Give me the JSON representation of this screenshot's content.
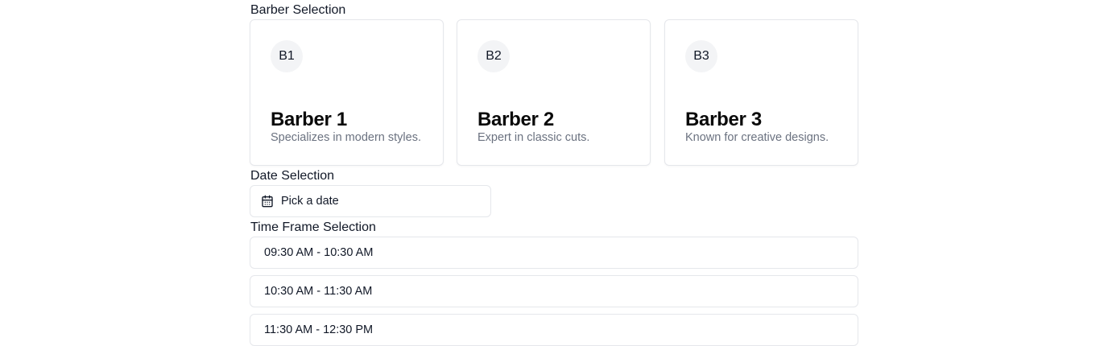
{
  "barber_section": {
    "label": "Barber Selection",
    "barbers": [
      {
        "initials": "B1",
        "name": "Barber 1",
        "description": "Specializes in modern styles."
      },
      {
        "initials": "B2",
        "name": "Barber 2",
        "description": "Expert in classic cuts."
      },
      {
        "initials": "B3",
        "name": "Barber 3",
        "description": "Known for creative designs."
      }
    ]
  },
  "date_section": {
    "label": "Date Selection",
    "button_label": "Pick a date",
    "icon": "calendar-icon"
  },
  "time_section": {
    "label": "Time Frame Selection",
    "slots": [
      "09:30 AM - 10:30 AM",
      "10:30 AM - 11:30 AM",
      "11:30 AM - 12:30 PM"
    ]
  },
  "colors": {
    "border": "#e5e7eb",
    "muted_text": "#6b7280",
    "avatar_bg": "#f3f4f6"
  }
}
